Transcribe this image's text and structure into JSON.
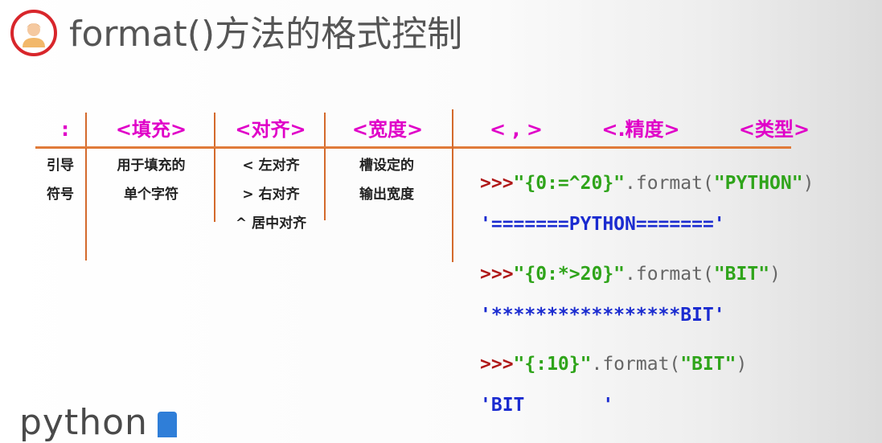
{
  "header": {
    "title": "format()方法的格式控制"
  },
  "table": {
    "columns": [
      {
        "head": ":",
        "desc": [
          "引导",
          "符号"
        ]
      },
      {
        "head": "<填充>",
        "desc": [
          "用于填充的",
          "单个字符"
        ]
      },
      {
        "head": "<对齐>",
        "desc": [
          "< 左对齐",
          "> 右对齐",
          "^ 居中对齐"
        ]
      },
      {
        "head": "<宽度>",
        "desc": [
          "槽设定的",
          "输出宽度"
        ]
      },
      {
        "head": "< , >",
        "desc": []
      },
      {
        "head": "<.精度>",
        "desc": []
      },
      {
        "head": "<类型>",
        "desc": []
      }
    ]
  },
  "examples": [
    {
      "prompt": ">>>",
      "str": "\"{0:=^20}\"",
      "method": ".format(",
      "arg": "\"PYTHON\"",
      "close": ")",
      "output": "'=======PYTHON======='"
    },
    {
      "prompt": ">>>",
      "str": "\"{0:*>20}\"",
      "method": ".format(",
      "arg": "\"BIT\"",
      "close": ")",
      "output": "'*****************BIT'"
    },
    {
      "prompt": ">>>",
      "str": "\"{:10}\"",
      "method": ".format(",
      "arg": "\"BIT\"",
      "close": ")",
      "output": "'BIT       '"
    }
  ],
  "logo": {
    "text": "python"
  },
  "colors": {
    "accent": "#e000c8",
    "divider": "#e07b3a",
    "prompt": "#b01818",
    "string": "#2fa41a",
    "output": "#1a2bd0",
    "avatar_ring": "#d8262b"
  },
  "icons": {
    "avatar": "person-avatar-icon",
    "logo_mark": "python-logo-icon"
  }
}
